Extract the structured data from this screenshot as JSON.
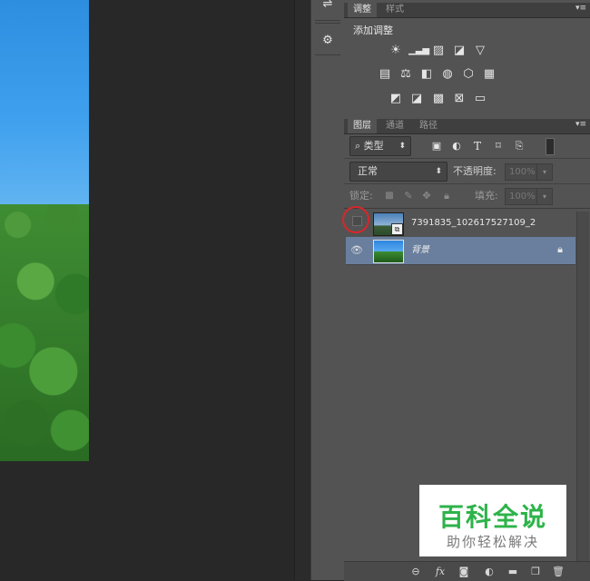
{
  "adjustments_panel": {
    "tabs": [
      "调整",
      "样式"
    ],
    "heading": "添加调整",
    "icons_row1": [
      "brightness-icon",
      "levels-icon",
      "curves-icon",
      "exposure-icon",
      "vibrance-icon"
    ],
    "icons_row2": [
      "hue-saturation-icon",
      "color-balance-icon",
      "black-white-icon",
      "photo-filter-icon",
      "channel-mixer-icon",
      "color-lookup-icon"
    ],
    "icons_row3": [
      "invert-icon",
      "posterize-icon",
      "threshold-icon",
      "selective-color-icon",
      "gradient-map-icon"
    ]
  },
  "layers_panel": {
    "tabs": [
      "图层",
      "通道",
      "路径"
    ],
    "filter_kind": "类型",
    "blend_mode": "正常",
    "opacity_label": "不透明度:",
    "opacity_value": "100%",
    "lock_label": "锁定:",
    "fill_label": "填充:",
    "fill_value": "100%",
    "layers": [
      {
        "name": "7391835_102617527109_2",
        "visible": false,
        "selected": false
      },
      {
        "name": "背景",
        "visible": true,
        "selected": true,
        "locked": true
      }
    ]
  },
  "watermark": {
    "title": "百科全说",
    "subtitle": "助你轻松解决"
  },
  "colors": {
    "panel_bg": "#535353",
    "selected_layer": "#6a7f9e",
    "highlight_circle": "#d9262b",
    "watermark_green": "#2eb34a"
  }
}
